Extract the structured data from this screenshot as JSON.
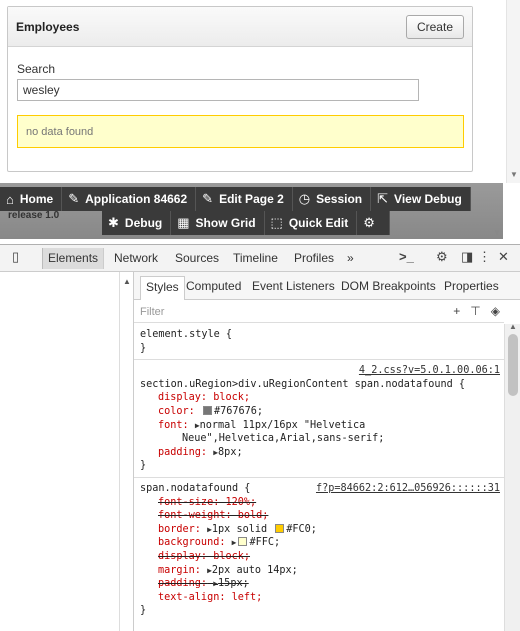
{
  "region": {
    "title": "Employees",
    "create_label": "Create",
    "search_label": "Search",
    "search_value": "wesley",
    "no_data": "no data found"
  },
  "devbar": {
    "release": "release 1.0",
    "row1": [
      {
        "icon": "home-icon",
        "glyph": "⌂",
        "label": "Home"
      },
      {
        "icon": "edit-icon",
        "glyph": "✎",
        "label": "Application 84662"
      },
      {
        "icon": "edit-page-icon",
        "glyph": "✎",
        "label": "Edit Page 2"
      },
      {
        "icon": "clock-icon",
        "glyph": "◷",
        "label": "Session"
      },
      {
        "icon": "debug-view-icon",
        "glyph": "⇱",
        "label": "View Debug"
      }
    ],
    "row2": [
      {
        "icon": "bug-icon",
        "glyph": "✱",
        "label": "Debug"
      },
      {
        "icon": "grid-icon",
        "glyph": "▦",
        "label": "Show Grid"
      },
      {
        "icon": "quick-edit-icon",
        "glyph": "⬚",
        "label": "Quick Edit"
      },
      {
        "icon": "gear-icon",
        "glyph": "⚙",
        "label": ""
      }
    ]
  },
  "devtools": {
    "tabs": [
      "Elements",
      "Network",
      "Sources",
      "Timeline",
      "Profiles"
    ],
    "active_tab": "Elements",
    "more": "»",
    "sidebar_tabs": [
      "Styles",
      "Computed",
      "Event Listeners",
      "DOM Breakpoints",
      "Properties"
    ],
    "active_sidebar_tab": "Styles",
    "filter_placeholder": "Filter",
    "rules": {
      "r1_selector": "element.style {",
      "r1_close": "}",
      "r2_source": "4_2.css?v=5.0.1.00.06:1",
      "r2_selector": "section.uRegion>div.uRegionContent span.nodatafound {",
      "r2_display": "display: block;",
      "r2_color_name": "color:",
      "r2_color_val": "#767676;",
      "r2_font_name": "font:",
      "r2_font_val": "normal 11px/16px \"Helvetica",
      "r2_font_val2": "Neue\",Helvetica,Arial,sans-serif;",
      "r2_padding_name": "padding:",
      "r2_padding_val": "8px;",
      "r2_close": "}",
      "r3_selector": "span.nodatafound {",
      "r3_source": "f?p=84662:2:612…056926::::::31",
      "r3_fontsize": "font-size: 120%;",
      "r3_fontweight": "font-weight: bold;",
      "r3_border_name": "border:",
      "r3_border_val1": "1px solid",
      "r3_border_val2": "#FC0;",
      "r3_bg_name": "background:",
      "r3_bg_val": "#FFC;",
      "r3_display": "display: block;",
      "r3_margin_name": "margin:",
      "r3_margin_val": "2px auto 14px;",
      "r3_padding_name": "padding:",
      "r3_padding_val": "15px;",
      "r3_textalign": "text-align: left;",
      "r3_close": "}"
    }
  },
  "colors": {
    "swatch_767676": "#767676",
    "swatch_fc0": "#FFCC00",
    "swatch_ffc": "#FFFFCC"
  }
}
